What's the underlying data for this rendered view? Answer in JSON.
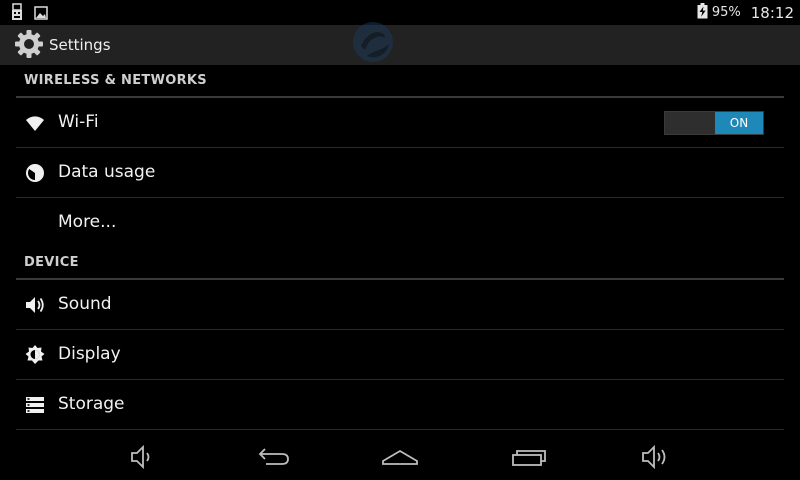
{
  "status_bar": {
    "left_icons": [
      "usb-icon",
      "image-icon"
    ],
    "battery_icon": "battery-charging-icon",
    "battery_percent": "95%",
    "time": "18:12"
  },
  "action_bar": {
    "icon": "gear-icon",
    "title": "Settings"
  },
  "sections": [
    {
      "header": "WIRELESS & NETWORKS",
      "items": [
        {
          "label": "Wi-Fi",
          "icon": "wifi-icon",
          "toggle": "ON"
        },
        {
          "label": "Data usage",
          "icon": "data-usage-icon"
        },
        {
          "label": "More...",
          "icon": ""
        }
      ]
    },
    {
      "header": "DEVICE",
      "items": [
        {
          "label": "Sound",
          "icon": "volume-icon"
        },
        {
          "label": "Display",
          "icon": "display-brightness-icon"
        },
        {
          "label": "Storage",
          "icon": "storage-icon"
        }
      ]
    }
  ],
  "nav_bar": {
    "buttons": [
      "volume-down-icon",
      "back-icon",
      "home-icon",
      "recent-apps-icon",
      "volume-up-icon"
    ]
  },
  "colors": {
    "toggle_on": "#1e88b8",
    "action_bar_bg": "#222222",
    "divider": "#3a3a3a"
  }
}
